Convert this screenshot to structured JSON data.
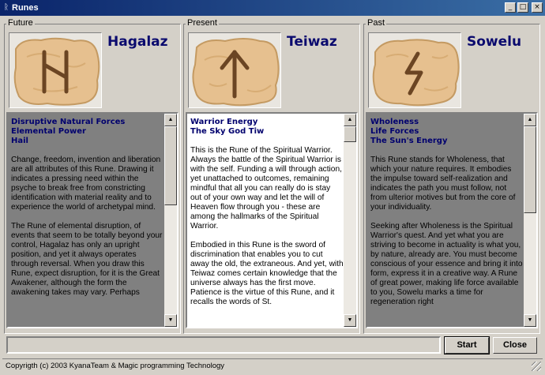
{
  "window": {
    "title": "Runes",
    "minimize_glyph": "_",
    "maximize_glyph": "□",
    "close_glyph": "×"
  },
  "panels": [
    {
      "label": "Future",
      "rune_name": "Hagalaz",
      "glyph": "hagalaz-rune",
      "state": "dimmed",
      "headings": [
        "Disruptive Natural Forces",
        "Elemental Power",
        "Hail"
      ],
      "paragraphs": [
        "Change, freedom, invention and liberation are all attributes of this Rune. Drawing it indicates a pressing need within the psyche to break free from constricting identification with material reality and to experience the world of archetypal mind.",
        "The Rune of elemental disruption, of events that seem to be totally beyond your control, Hagalaz has only an upright position, and yet it always operates through reversal. When you draw this Rune, expect disruption, for it is the Great Awakener, although the form the awakening takes may vary. Perhaps"
      ]
    },
    {
      "label": "Present",
      "rune_name": "Teiwaz",
      "glyph": "teiwaz-rune",
      "state": "active",
      "headings": [
        "Warrior Energy",
        "The Sky God Tiw"
      ],
      "paragraphs": [
        "This is the Rune of the Spiritual Warrior. Always the battle of the Spiritual Warrior is with the self. Funding a will through action, yet unattached to outcomes, remaining mindful that all you can really do is stay out of your own way and let the will of Heaven flow through you - these are among the hallmarks of the Spiritual Warrior.",
        "Embodied in this Rune is the sword of discrimination that enables you to cut away the old, the extraneous. And yet, with Teiwaz comes certain knowledge that the universe always has the first move. Patience is the virtue of this Rune, and it recalls the words of St."
      ]
    },
    {
      "label": "Past",
      "rune_name": "Sowelu",
      "glyph": "sowelu-rune",
      "state": "dimmed",
      "headings": [
        "Wholeness",
        "Life Forces",
        "The Sun's Energy"
      ],
      "paragraphs": [
        "This Rune stands for Wholeness, that which your nature requires. It embodies the impulse toward self-realization and indicates the path you must follow, not from ulterior motives but from the core of your individuality.",
        "Seeking after Wholeness is the Spiritual Warrior's quest. And yet what you are striving to become in actuality is what you, by nature, already are. You must become conscious of your essence and bring it into form, express it in a creative way. A Rune of great power, making life force available to you, Sowelu marks a time for regeneration right"
      ]
    }
  ],
  "buttons": {
    "start": "Start",
    "close": "Close"
  },
  "status": {
    "copyright": "Copyrigth (c) 2003 KyanaTeam & Magic programming Technology"
  },
  "colors": {
    "title_bar": "#0a246a",
    "rune_name": "#0a0a6e",
    "heading_text": "#00006e",
    "dimmed_box": "#808080",
    "stone_fill": "#e6c08f",
    "rune_carving": "#6b4523"
  }
}
